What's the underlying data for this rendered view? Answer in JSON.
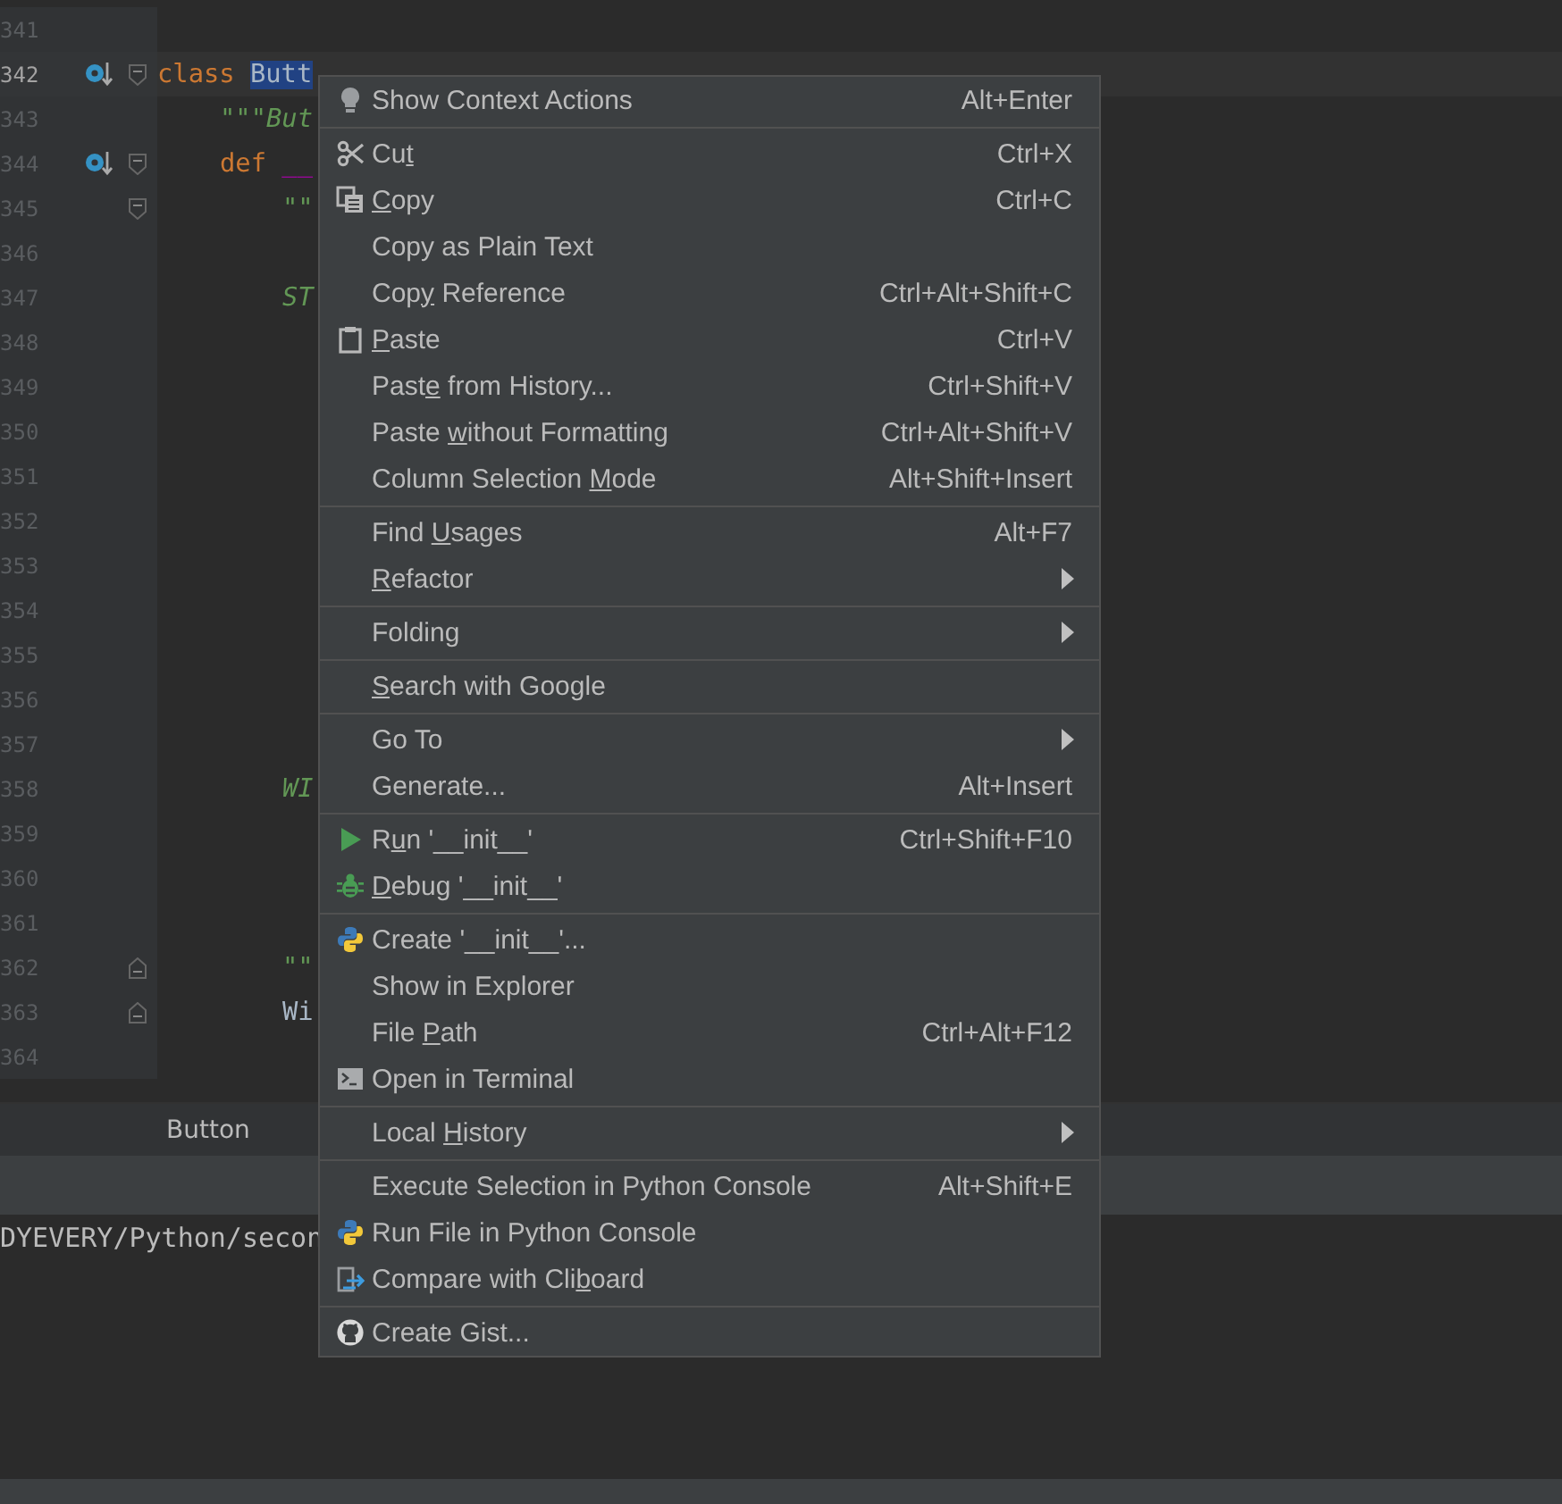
{
  "editor": {
    "lines": [
      {
        "number": "341",
        "current": false,
        "override": false,
        "fold_start": false,
        "fold_end": false
      },
      {
        "number": "342",
        "current": true,
        "override": true,
        "fold_start": true,
        "fold_end": false,
        "kind": "top",
        "tokens": [
          {
            "text": "class ",
            "kind": "keyword"
          },
          {
            "text": "Butt",
            "kind": "selected"
          }
        ]
      },
      {
        "number": "343",
        "current": false,
        "override": false,
        "fold_start": false,
        "fold_end": false,
        "kind": "member",
        "tokens": [
          {
            "text": "\"\"\"But",
            "kind": "docstring"
          }
        ]
      },
      {
        "number": "344",
        "current": false,
        "override": true,
        "fold_start": true,
        "fold_end": false,
        "kind": "member",
        "tokens": [
          {
            "text": "def ",
            "kind": "keyword"
          },
          {
            "text": "__",
            "kind": "magic"
          }
        ]
      },
      {
        "number": "345",
        "current": false,
        "override": false,
        "fold_start": true,
        "fold_end": false,
        "kind": "body",
        "tokens": [
          {
            "text": "\"\"",
            "kind": "docstring"
          }
        ]
      },
      {
        "number": "346",
        "current": false,
        "override": false,
        "fold_start": false,
        "fold_end": false
      },
      {
        "number": "347",
        "current": false,
        "override": false,
        "fold_start": false,
        "fold_end": false,
        "kind": "body",
        "tokens": [
          {
            "text": "ST",
            "kind": "docstring"
          }
        ]
      },
      {
        "number": "348",
        "current": false,
        "override": false,
        "fold_start": false,
        "fold_end": false
      },
      {
        "number": "349",
        "current": false,
        "override": false,
        "fold_start": false,
        "fold_end": false
      },
      {
        "number": "350",
        "current": false,
        "override": false,
        "fold_start": false,
        "fold_end": false
      },
      {
        "number": "351",
        "current": false,
        "override": false,
        "fold_start": false,
        "fold_end": false
      },
      {
        "number": "352",
        "current": false,
        "override": false,
        "fold_start": false,
        "fold_end": false
      },
      {
        "number": "353",
        "current": false,
        "override": false,
        "fold_start": false,
        "fold_end": false
      },
      {
        "number": "354",
        "current": false,
        "override": false,
        "fold_start": false,
        "fold_end": false
      },
      {
        "number": "355",
        "current": false,
        "override": false,
        "fold_start": false,
        "fold_end": false
      },
      {
        "number": "356",
        "current": false,
        "override": false,
        "fold_start": false,
        "fold_end": false
      },
      {
        "number": "357",
        "current": false,
        "override": false,
        "fold_start": false,
        "fold_end": false
      },
      {
        "number": "358",
        "current": false,
        "override": false,
        "fold_start": false,
        "fold_end": false,
        "kind": "body",
        "tokens": [
          {
            "text": "WI",
            "kind": "docstring"
          }
        ]
      },
      {
        "number": "359",
        "current": false,
        "override": false,
        "fold_start": false,
        "fold_end": false
      },
      {
        "number": "360",
        "current": false,
        "override": false,
        "fold_start": false,
        "fold_end": false
      },
      {
        "number": "361",
        "current": false,
        "override": false,
        "fold_start": false,
        "fold_end": false
      },
      {
        "number": "362",
        "current": false,
        "override": false,
        "fold_start": false,
        "fold_end": true,
        "kind": "body",
        "tokens": [
          {
            "text": "\"\"",
            "kind": "docstring"
          }
        ]
      },
      {
        "number": "363",
        "current": false,
        "override": false,
        "fold_start": false,
        "fold_end": true,
        "kind": "body",
        "tokens": [
          {
            "text": "Wi",
            "kind": "plain"
          }
        ]
      },
      {
        "number": "364",
        "current": false,
        "override": false,
        "fold_start": false,
        "fold_end": false
      }
    ]
  },
  "bottom_panel": {
    "tab": "Button",
    "console_line": "DYEVERY/Python/secon"
  },
  "context_menu": {
    "groups": [
      {
        "items": [
          {
            "kind": "bulb",
            "label": [
              {
                "text": "Show Context Actions",
                "underlined": false
              }
            ],
            "shortcut": "Alt+Enter",
            "submenu": false
          }
        ]
      },
      {
        "items": [
          {
            "kind": "scissors",
            "label": [
              {
                "text": "Cu",
                "underlined": false
              },
              {
                "text": "t",
                "underlined": true
              }
            ],
            "shortcut": "Ctrl+X",
            "submenu": false
          },
          {
            "kind": "copy",
            "label": [
              {
                "text": "C",
                "underlined": true
              },
              {
                "text": "opy",
                "underlined": false
              }
            ],
            "shortcut": "Ctrl+C",
            "submenu": false
          },
          {
            "label": [
              {
                "text": "Copy as Plain Text",
                "underlined": false
              }
            ],
            "submenu": false
          },
          {
            "label": [
              {
                "text": "Cop",
                "underlined": false
              },
              {
                "text": "y",
                "underlined": true
              },
              {
                "text": " Reference",
                "underlined": false
              }
            ],
            "shortcut": "Ctrl+Alt+Shift+C",
            "submenu": false
          },
          {
            "kind": "clipboard",
            "label": [
              {
                "text": "P",
                "underlined": true
              },
              {
                "text": "aste",
                "underlined": false
              }
            ],
            "shortcut": "Ctrl+V",
            "submenu": false
          },
          {
            "label": [
              {
                "text": "Past",
                "underlined": false
              },
              {
                "text": "e",
                "underlined": true
              },
              {
                "text": " from History...",
                "underlined": false
              }
            ],
            "shortcut": "Ctrl+Shift+V",
            "submenu": false
          },
          {
            "label": [
              {
                "text": "Paste ",
                "underlined": false
              },
              {
                "text": "w",
                "underlined": true
              },
              {
                "text": "ithout Formatting",
                "underlined": false
              }
            ],
            "shortcut": "Ctrl+Alt+Shift+V",
            "submenu": false
          },
          {
            "label": [
              {
                "text": "Column Selection ",
                "underlined": false
              },
              {
                "text": "M",
                "underlined": true
              },
              {
                "text": "ode",
                "underlined": false
              }
            ],
            "shortcut": "Alt+Shift+Insert",
            "submenu": false
          }
        ]
      },
      {
        "items": [
          {
            "label": [
              {
                "text": "Find ",
                "underlined": false
              },
              {
                "text": "U",
                "underlined": true
              },
              {
                "text": "sages",
                "underlined": false
              }
            ],
            "shortcut": "Alt+F7",
            "submenu": false
          },
          {
            "label": [
              {
                "text": "R",
                "underlined": true
              },
              {
                "text": "efactor",
                "underlined": false
              }
            ],
            "submenu": true
          }
        ]
      },
      {
        "items": [
          {
            "label": [
              {
                "text": "Folding",
                "underlined": false
              }
            ],
            "submenu": true
          }
        ]
      },
      {
        "items": [
          {
            "label": [
              {
                "text": "S",
                "underlined": true
              },
              {
                "text": "earch with Google",
                "underlined": false
              }
            ],
            "submenu": false
          }
        ]
      },
      {
        "items": [
          {
            "label": [
              {
                "text": "Go To",
                "underlined": false
              }
            ],
            "submenu": true
          },
          {
            "label": [
              {
                "text": "Generate...",
                "underlined": false
              }
            ],
            "shortcut": "Alt+Insert",
            "submenu": false
          }
        ]
      },
      {
        "items": [
          {
            "kind": "run",
            "label": [
              {
                "text": "R",
                "underlined": false
              },
              {
                "text": "u",
                "underlined": true
              },
              {
                "text": "n '__init__'",
                "underlined": false
              }
            ],
            "shortcut": "Ctrl+Shift+F10",
            "submenu": false
          },
          {
            "kind": "bug",
            "label": [
              {
                "text": "D",
                "underlined": true
              },
              {
                "text": "ebug '__init__'",
                "underlined": false
              }
            ],
            "submenu": false
          }
        ]
      },
      {
        "items": [
          {
            "kind": "python",
            "label": [
              {
                "text": "Create '__init__'...",
                "underlined": false
              }
            ],
            "submenu": false
          },
          {
            "label": [
              {
                "text": "Show in Explorer",
                "underlined": false
              }
            ],
            "submenu": false
          },
          {
            "label": [
              {
                "text": "File ",
                "underlined": false
              },
              {
                "text": "P",
                "underlined": true
              },
              {
                "text": "ath",
                "underlined": false
              }
            ],
            "shortcut": "Ctrl+Alt+F12",
            "submenu": false
          },
          {
            "kind": "terminal",
            "label": [
              {
                "text": "Open in Terminal",
                "underlined": false
              }
            ],
            "submenu": false
          }
        ]
      },
      {
        "items": [
          {
            "label": [
              {
                "text": "Local ",
                "underlined": false
              },
              {
                "text": "H",
                "underlined": true
              },
              {
                "text": "istory",
                "underlined": false
              }
            ],
            "submenu": true
          }
        ]
      },
      {
        "items": [
          {
            "label": [
              {
                "text": "Execute Selection in Python Console",
                "underlined": false
              }
            ],
            "shortcut": "Alt+Shift+E",
            "submenu": false
          },
          {
            "kind": "python",
            "label": [
              {
                "text": "Run File in Python Console",
                "underlined": false
              }
            ],
            "submenu": false
          },
          {
            "kind": "compare",
            "label": [
              {
                "text": "Compare with Cli",
                "underlined": false
              },
              {
                "text": "b",
                "underlined": true
              },
              {
                "text": "oard",
                "underlined": false
              }
            ],
            "submenu": false
          }
        ]
      },
      {
        "items": [
          {
            "kind": "github",
            "label": [
              {
                "text": "Create Gist...",
                "underlined": false
              }
            ],
            "submenu": false
          }
        ]
      }
    ]
  }
}
